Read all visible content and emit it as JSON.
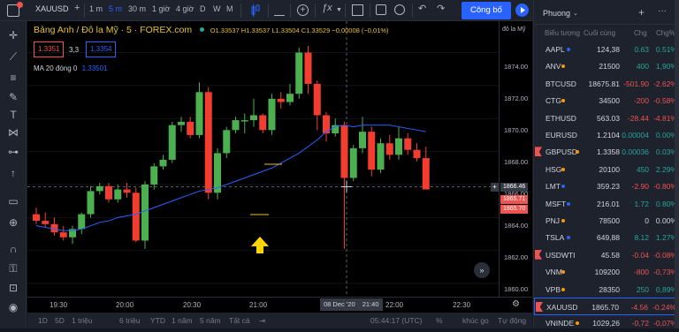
{
  "toolbar": {
    "symbol": "XAUUSD",
    "intervals": [
      "1 m",
      "5 m",
      "30 m",
      "1 giờ",
      "4 giờ",
      "D",
      "W",
      "M"
    ],
    "active_interval": "5 m",
    "publish_label": "Công bố"
  },
  "legend": {
    "title": "Bảng Anh / Đô la Mỹ · 5 · FOREX.com",
    "ohlc": "O1.33537 H1.33537 L1.33504 C1.33529 −0,00008 (−0,01%)",
    "sell_price": "1.3351",
    "spread": "3,3",
    "buy_price": "1.3354",
    "ma_label": "MA 20 đóng 0",
    "ma_value": "1.33501"
  },
  "price_scale": {
    "currency": "đô la Mỹ",
    "ticks": [
      "1874.00",
      "1872.00",
      "1870.00",
      "1868.00",
      "1866.00",
      "1864.00",
      "1862.00",
      "1860.00"
    ],
    "crosshair_price": "1866.46",
    "marker_1": "1865.71",
    "marker_2": "1865.70"
  },
  "time_axis": {
    "ticks": [
      "19:30",
      "20:00",
      "20:30",
      "21:00",
      "22:00",
      "22:30"
    ],
    "crosshair_label": "08 Dec '20",
    "crosshair_time": "21:40"
  },
  "bottom_bar": {
    "ranges": [
      "1D",
      "5D",
      "1 triệu",
      "6 triệu",
      "YTD",
      "1 năm",
      "5 năm",
      "Tất cả"
    ],
    "clock": "05:44:17 (UTC)",
    "pct": "%",
    "log": "log",
    "auto": "Tự động",
    "khuc_go": "khúc gọ"
  },
  "watchlist": {
    "title": "Phuong",
    "headers": [
      "Biểu tượng",
      "Cuối cùng",
      "Chg",
      "Chg%"
    ],
    "rows": [
      {
        "sym": "AAPL",
        "last": "124,38",
        "chg": "0.63",
        "chgp": "0.51%",
        "dir": "up",
        "dot": "#2962ff"
      },
      {
        "sym": "ANV",
        "last": "21500",
        "chg": "400",
        "chgp": "1,90%",
        "dir": "up",
        "dot": "#ff9800"
      },
      {
        "sym": "BTCUSD",
        "last": "18675.81",
        "chg": "-501.90",
        "chgp": "-2.62%",
        "dir": "dn",
        "dot": ""
      },
      {
        "sym": "CTG",
        "last": "34500",
        "chg": "-200",
        "chgp": "-0.58%",
        "dir": "dn",
        "dot": "#ff9800"
      },
      {
        "sym": "ETHUSD",
        "last": "563.03",
        "chg": "-28.44",
        "chgp": "-4.81%",
        "dir": "dn",
        "dot": ""
      },
      {
        "sym": "EURUSD",
        "last": "1.2104",
        "chg": "0.00004",
        "chgp": "0.00%",
        "dir": "up",
        "dot": ""
      },
      {
        "sym": "GBPUSD",
        "last": "1.3358",
        "chg": "0.00036",
        "chgp": "0.03%",
        "dir": "up",
        "dot": "#ff9800",
        "flag": true
      },
      {
        "sym": "HSG",
        "last": "20100",
        "chg": "450",
        "chgp": "2.29%",
        "dir": "up",
        "dot": "#ff9800"
      },
      {
        "sym": "LMT",
        "last": "359.23",
        "chg": "-2.90",
        "chgp": "-0.80%",
        "dir": "dn",
        "dot": "#2962ff"
      },
      {
        "sym": "MSFT",
        "last": "216.01",
        "chg": "1.72",
        "chgp": "0.80%",
        "dir": "up",
        "dot": "#2962ff"
      },
      {
        "sym": "PNJ",
        "last": "78500",
        "chg": "0",
        "chgp": "0.00%",
        "dir": "nu",
        "dot": "#ff9800"
      },
      {
        "sym": "TSLA",
        "last": "649,88",
        "chg": "8.12",
        "chgp": "1.27%",
        "dir": "up",
        "dot": "#2962ff"
      },
      {
        "sym": "USDWTI",
        "last": "45.58",
        "chg": "-0.04",
        "chgp": "-0.08%",
        "dir": "dn",
        "dot": "",
        "flag": true
      },
      {
        "sym": "VNM",
        "last": "109200",
        "chg": "-800",
        "chgp": "-0,73%",
        "dir": "dn",
        "dot": "#ff9800"
      },
      {
        "sym": "VPB",
        "last": "28350",
        "chg": "250",
        "chgp": "0,89%",
        "dir": "up",
        "dot": "#ff9800"
      },
      {
        "sym": "XAUUSD",
        "last": "1865.70",
        "chg": "-4.56",
        "chgp": "-0.24%",
        "dir": "dn",
        "dot": "",
        "flag": true,
        "selected": true
      },
      {
        "sym": "VNINDE",
        "last": "1029,26",
        "chg": "-0,72",
        "chgp": "-0,07%",
        "dir": "dn",
        "dot": "#ff9800"
      }
    ]
  },
  "chart_data": {
    "type": "candlestick",
    "ylim": [
      1859.2,
      1875.9
    ],
    "candles": [
      [
        1864.2,
        1864.6,
        1863.6,
        1863.8
      ],
      [
        1863.8,
        1864.3,
        1863.4,
        1863.6
      ],
      [
        1863.6,
        1864.0,
        1862.9,
        1863.1
      ],
      [
        1863.1,
        1863.5,
        1862.6,
        1862.8
      ],
      [
        1862.8,
        1863.5,
        1862.4,
        1863.3
      ],
      [
        1863.3,
        1864.3,
        1863.0,
        1864.2
      ],
      [
        1864.2,
        1865.9,
        1864.0,
        1865.6
      ],
      [
        1865.6,
        1866.1,
        1865.4,
        1865.9
      ],
      [
        1865.9,
        1866.1,
        1864.9,
        1865.1
      ],
      [
        1865.1,
        1866.0,
        1864.9,
        1865.7
      ],
      [
        1865.7,
        1866.1,
        1865.2,
        1865.5
      ],
      [
        1865.5,
        1865.8,
        1862.5,
        1862.6
      ],
      [
        1862.6,
        1866.2,
        1862.1,
        1866.0
      ],
      [
        1866.0,
        1867.3,
        1865.7,
        1867.1
      ],
      [
        1867.1,
        1867.8,
        1866.9,
        1867.5
      ],
      [
        1867.5,
        1869.8,
        1867.3,
        1869.6
      ],
      [
        1869.6,
        1870.1,
        1869.2,
        1869.8
      ],
      [
        1869.8,
        1870.1,
        1868.8,
        1869.0
      ],
      [
        1869.0,
        1872.2,
        1868.8,
        1871.6
      ],
      [
        1871.6,
        1871.9,
        1865.1,
        1865.5
      ],
      [
        1865.5,
        1868.2,
        1865.1,
        1867.9
      ],
      [
        1867.9,
        1869.5,
        1867.6,
        1869.3
      ],
      [
        1869.3,
        1870.1,
        1869.1,
        1869.9
      ],
      [
        1869.9,
        1870.3,
        1869.1,
        1869.9
      ],
      [
        1869.9,
        1871.2,
        1869.5,
        1870.2
      ],
      [
        1870.2,
        1870.3,
        1869.1,
        1869.3
      ],
      [
        1869.3,
        1871.5,
        1869.0,
        1871.2
      ],
      [
        1871.2,
        1871.6,
        1870.6,
        1871.0
      ],
      [
        1871.0,
        1872.1,
        1870.8,
        1871.5
      ],
      [
        1871.5,
        1874.3,
        1871.2,
        1874.0
      ],
      [
        1874.0,
        1874.4,
        1871.5,
        1872.1
      ],
      [
        1872.1,
        1872.3,
        1869.3,
        1870.2
      ],
      [
        1870.2,
        1870.4,
        1868.6,
        1869.1
      ],
      [
        1869.1,
        1870.0,
        1868.9,
        1869.6
      ],
      [
        1869.6,
        1869.8,
        1862.1,
        1866.4
      ],
      [
        1866.4,
        1868.4,
        1866.2,
        1868.2
      ],
      [
        1868.2,
        1870.1,
        1867.9,
        1869.2
      ],
      [
        1869.2,
        1869.5,
        1866.5,
        1866.9
      ],
      [
        1866.9,
        1868.8,
        1866.7,
        1868.5
      ],
      [
        1868.5,
        1869.0,
        1867.5,
        1867.8
      ],
      [
        1867.8,
        1869.5,
        1867.5,
        1868.8
      ],
      [
        1868.8,
        1869.1,
        1867.8,
        1868.1
      ],
      [
        1868.1,
        1868.5,
        1867.4,
        1867.6
      ],
      [
        1867.6,
        1868.3,
        1865.7,
        1865.7
      ]
    ],
    "ma_values": [
      1863.5,
      1863.4,
      1863.3,
      1863.2,
      1863.2,
      1863.3,
      1863.5,
      1863.7,
      1863.8,
      1864.0,
      1864.1,
      1864.2,
      1864.4,
      1864.6,
      1864.8,
      1865.0,
      1865.2,
      1865.4,
      1865.6,
      1865.7,
      1865.8,
      1866.0,
      1866.2,
      1866.4,
      1866.6,
      1866.8,
      1867.0,
      1867.3,
      1867.6,
      1867.9,
      1868.3,
      1868.7,
      1869.2,
      1869.5,
      1869.6,
      1869.5,
      1869.6,
      1869.6,
      1869.6,
      1869.6,
      1869.5,
      1869.4,
      1869.3,
      1869.2
    ]
  }
}
